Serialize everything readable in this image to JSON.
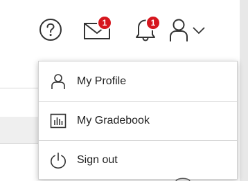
{
  "header": {
    "help_icon": "question-circle-icon",
    "messages": {
      "icon": "envelope-icon",
      "badge": "1"
    },
    "notifications": {
      "icon": "bell-icon",
      "badge": "1"
    },
    "account": {
      "icon": "user-icon",
      "chevron": "chevron-down-icon"
    }
  },
  "menu": {
    "items": [
      {
        "label": "My Profile",
        "icon": "user-icon"
      },
      {
        "label": "My Gradebook",
        "icon": "gradebook-icon"
      },
      {
        "label": "Sign out",
        "icon": "power-icon"
      }
    ]
  },
  "colors": {
    "badge": "#d6161e",
    "icon_stroke": "#333333",
    "text": "#222222"
  }
}
